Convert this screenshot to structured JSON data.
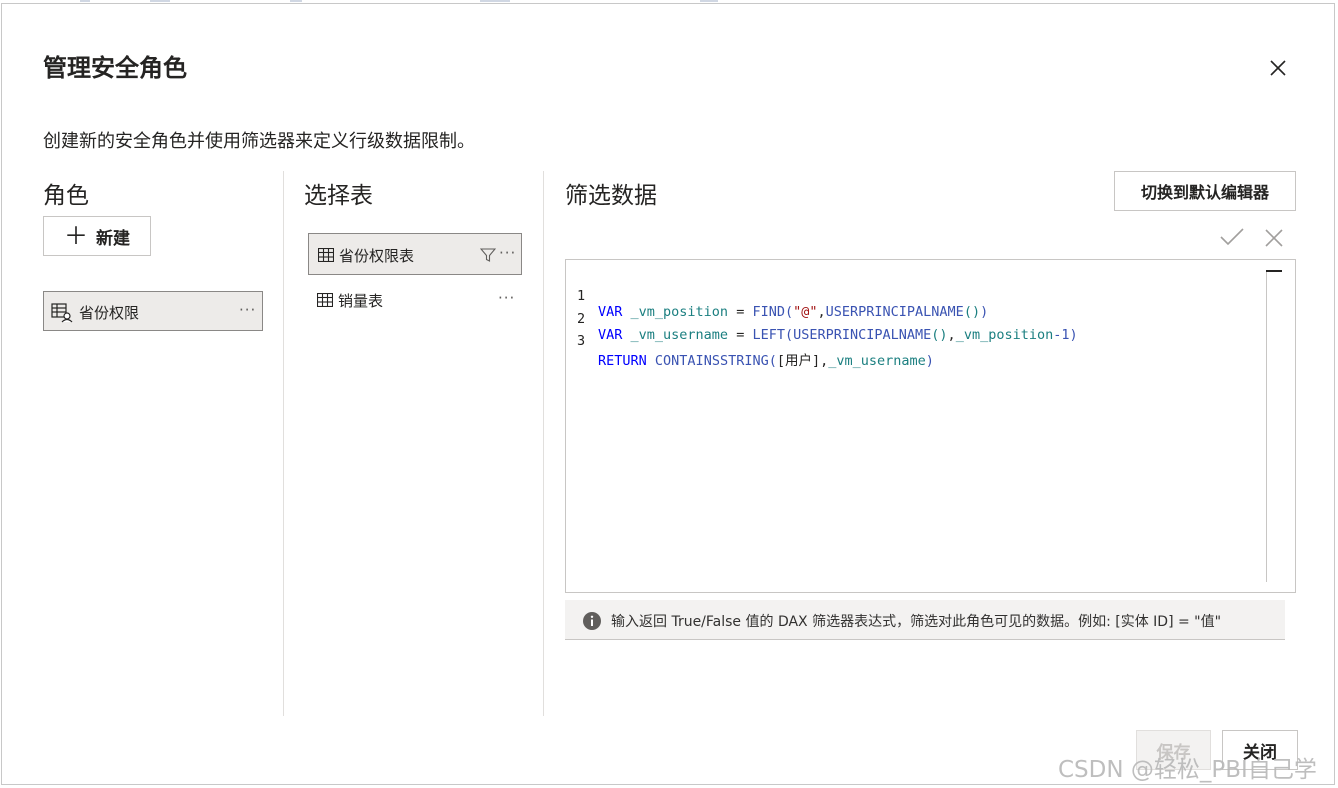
{
  "dialog": {
    "title": "管理安全角色",
    "subtitle": "创建新的安全角色并使用筛选器来定义行级数据限制。"
  },
  "roles": {
    "heading": "角色",
    "new_label": "新建",
    "items": [
      {
        "label": "省份权限",
        "icon": "role-icon"
      }
    ]
  },
  "tables": {
    "heading": "选择表",
    "items": [
      {
        "label": "省份权限表",
        "icon": "table-icon",
        "filtered": true
      },
      {
        "label": "销量表",
        "icon": "table-icon",
        "filtered": false
      }
    ]
  },
  "filter": {
    "heading": "筛选数据",
    "switch_label": "切换到默认编辑器",
    "code": {
      "line_numbers": [
        "1",
        "2",
        "3"
      ],
      "l1": {
        "kw": "VAR",
        "var": "_vm_position",
        "eq": " = ",
        "fn": "FIND(",
        "str": "\"@\"",
        "comma": ",",
        "fn2": "USERPRINCIPALNAME",
        "paren": "()",
        "close": ")"
      },
      "l2": {
        "kw": "VAR",
        "var": "_vm_username",
        "eq": " = ",
        "fn": "LEFT(",
        "fn2": "USERPRINCIPALNAME",
        "paren": "()",
        "comma": ",",
        "var2": "_vm_position",
        "rest": "-1)"
      },
      "l3": {
        "kw": "RETURN",
        "fn": "CONTAINSSTRING(",
        "col": "[用户]",
        "comma": ",",
        "var": "_vm_username",
        "close": ")"
      }
    },
    "info_text": "输入返回 True/False 值的 DAX 筛选器表达式，筛选对此角色可见的数据。例如: [实体 ID] = \"值\""
  },
  "footer": {
    "save_label": "保存",
    "close_label": "关闭"
  },
  "watermark": "CSDN @轻松_PBI自己学",
  "colors": {
    "keyword": "#0000ff",
    "function": "#3a53b2",
    "variable": "#1b7f80",
    "string": "#a31515",
    "selected_bg": "#edebe9"
  }
}
